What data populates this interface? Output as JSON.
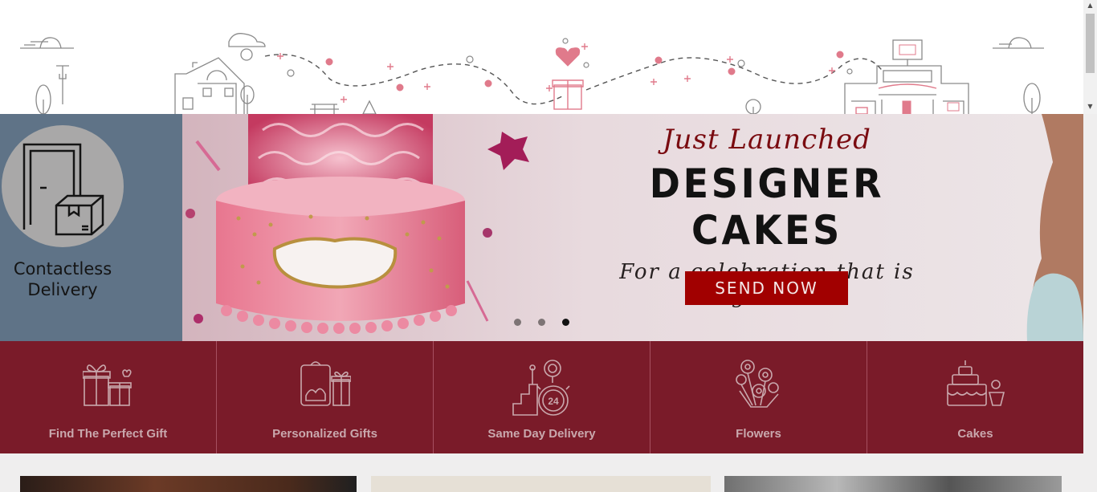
{
  "hero": {
    "contactless_label": "Contactless Delivery",
    "kicker": "Just Launched",
    "headline": "DESIGNER CAKES",
    "subheadline": "For a celebration that is grand",
    "cta_label": "SEND NOW",
    "slides_total": 3,
    "active_slide": 3
  },
  "categories": [
    {
      "label": "Find The Perfect Gift",
      "icon": "gift-boxes-icon"
    },
    {
      "label": "Personalized Gifts",
      "icon": "personalized-gift-icon"
    },
    {
      "label": "Same Day Delivery",
      "icon": "same-day-delivery-icon"
    },
    {
      "label": "Flowers",
      "icon": "flowers-icon"
    },
    {
      "label": "Cakes",
      "icon": "cakes-icon"
    }
  ],
  "colors": {
    "category_bg": "#7a1b29",
    "cta_bg": "#a10000",
    "contactless_bg": "#5f7387",
    "illustration_pink": "#e07a8b"
  }
}
